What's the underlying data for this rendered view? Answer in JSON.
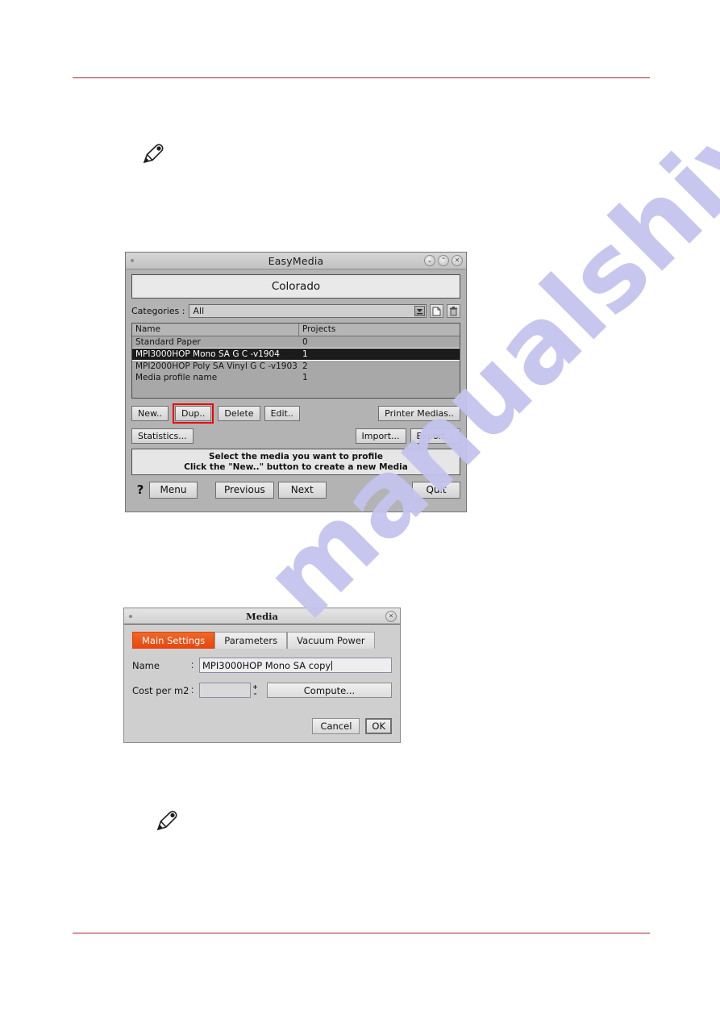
{
  "page": {
    "rule_color": "#a32733",
    "watermark_text": "manualshive.com",
    "watermark_color": "#c3c3ee"
  },
  "notes": [
    {
      "icon": "pencil-note-icon"
    },
    {
      "icon": "pencil-note-icon"
    }
  ],
  "easymedia": {
    "title": "EasyMedia",
    "window_buttons": [
      {
        "name": "minimize",
        "glyph": "⌄"
      },
      {
        "name": "maximize",
        "glyph": "⌃"
      },
      {
        "name": "close",
        "glyph": "✕"
      }
    ],
    "banner": "Colorado",
    "categories": {
      "label": "Categories  :",
      "value": "All",
      "dropdown_icon": "chevron-down-icon",
      "new_icon": "new-document-icon",
      "delete_icon": "trash-icon"
    },
    "list": {
      "columns": [
        "Name",
        "Projects"
      ],
      "rows": [
        {
          "name": "Standard Paper",
          "projects": "0",
          "selected": false
        },
        {
          "name": "MPI3000HOP Mono SA G C -v1904",
          "projects": "1",
          "selected": true
        },
        {
          "name": "MPI2000HOP Poly SA Vinyl G C -v1903",
          "projects": "2",
          "selected": false
        },
        {
          "name": "Media profile name",
          "projects": "1",
          "selected": false
        }
      ]
    },
    "buttons_row1": {
      "new": "New..",
      "dup": "Dup..",
      "delete": "Delete",
      "edit": "Edit..",
      "printer_medias": "Printer Medias.."
    },
    "buttons_row2": {
      "statistics": "Statistics...",
      "import": "Import...",
      "export": "Export..."
    },
    "highlight_color": "#ee0000",
    "message": {
      "line1": "Select the media you want to profile",
      "line2": "Click the \"New..\" button to create a new Media"
    },
    "footer": {
      "help": "?",
      "menu": "Menu",
      "previous": "Previous",
      "next": "Next",
      "quit": "Quit"
    }
  },
  "media_dialog": {
    "title": "Media",
    "close_icon": "close-icon",
    "tabs": [
      {
        "label": "Main Settings",
        "active": true
      },
      {
        "label": "Parameters",
        "active": false
      },
      {
        "label": "Vacuum Power",
        "active": false
      }
    ],
    "active_tab_color": "#e8430a",
    "name": {
      "label": "Name",
      "colon": ":",
      "value": "MPI3000HOP Mono SA copy"
    },
    "cost": {
      "label": "Cost per m2",
      "colon": ":",
      "value": "",
      "spin_up": "+",
      "spin_down": "–",
      "compute": "Compute..."
    },
    "footer": {
      "cancel": "Cancel",
      "ok": "OK"
    }
  }
}
